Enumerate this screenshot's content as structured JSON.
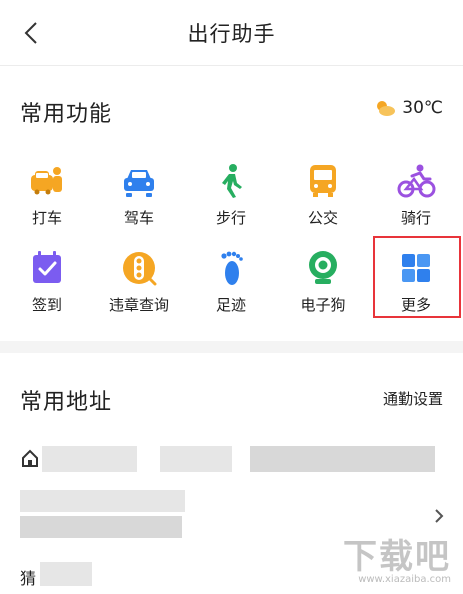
{
  "header": {
    "title": "出行助手",
    "back_icon": "chevron-left-icon"
  },
  "functions": {
    "title": "常用功能",
    "weather": {
      "icon": "partly-sunny-icon",
      "temperature": "30℃"
    },
    "items": [
      {
        "label": "打车",
        "icon": "taxi-icon",
        "color": "#f5a623"
      },
      {
        "label": "驾车",
        "icon": "car-icon",
        "color": "#2f80ed"
      },
      {
        "label": "步行",
        "icon": "walk-icon",
        "color": "#27ae60"
      },
      {
        "label": "公交",
        "icon": "bus-icon",
        "color": "#f5a623"
      },
      {
        "label": "骑行",
        "icon": "bike-icon",
        "color": "#9b51e0"
      },
      {
        "label": "签到",
        "icon": "checkin-icon",
        "color": "#7b5cf0"
      },
      {
        "label": "违章查询",
        "icon": "traffic-light-icon",
        "color": "#f5a623"
      },
      {
        "label": "足迹",
        "icon": "footprint-icon",
        "color": "#2f80ed"
      },
      {
        "label": "电子狗",
        "icon": "camera-icon",
        "color": "#27ae60"
      },
      {
        "label": "更多",
        "icon": "grid-icon",
        "color": "#2f80ed"
      }
    ]
  },
  "addresses": {
    "title": "常用地址",
    "commute_settings": "通勤设置",
    "home_icon": "home-icon",
    "guess_label": "猜"
  },
  "watermark": {
    "text": "下载吧",
    "url": "www.xiazaiba.com"
  }
}
